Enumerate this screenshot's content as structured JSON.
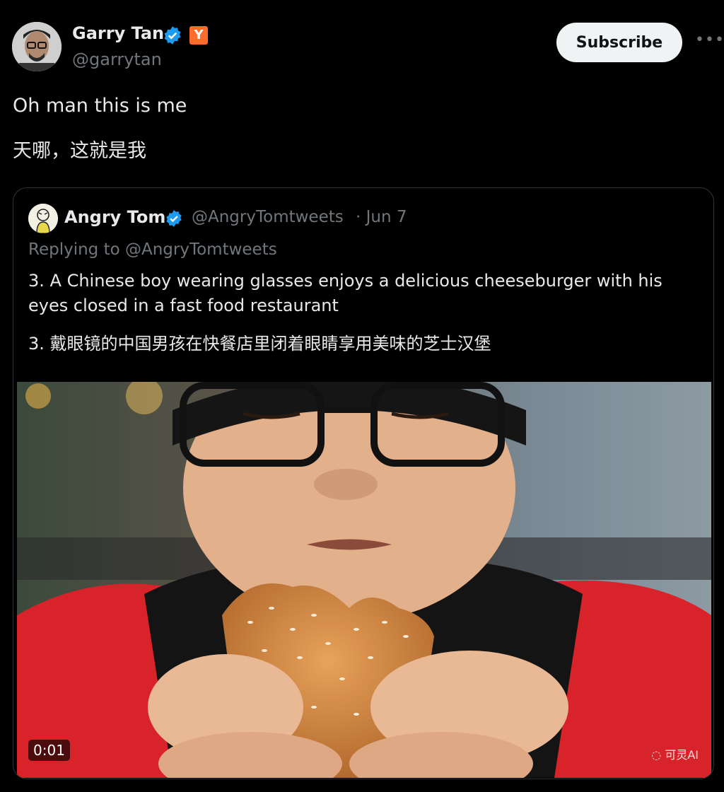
{
  "author": {
    "name": "Garry Tan",
    "handle": "@garrytan",
    "affiliation_badge": "Y"
  },
  "actions": {
    "subscribe_label": "Subscribe",
    "more_label": "•••"
  },
  "tweet": {
    "line1": "Oh man this is me",
    "line2": "天哪，这就是我"
  },
  "quoted": {
    "name": "Angry Tom",
    "handle": "@AngryTomtweets",
    "date": "· Jun 7",
    "replying_to": "Replying to @AngryTomtweets",
    "text_en": "3. A Chinese boy wearing glasses enjoys a delicious cheeseburger with his eyes closed in a fast food restaurant",
    "text_zh": "3. 戴眼镜的中国男孩在快餐店里闭着眼睛享用美味的芝士汉堡",
    "media": {
      "timecode": "0:01",
      "watermark": "可灵AI"
    }
  },
  "colors": {
    "background": "#000000",
    "verified": "#1d9bf0",
    "yc_orange": "#ff6b2b",
    "muted": "#71767b",
    "jacket_red": "#d8232a"
  }
}
